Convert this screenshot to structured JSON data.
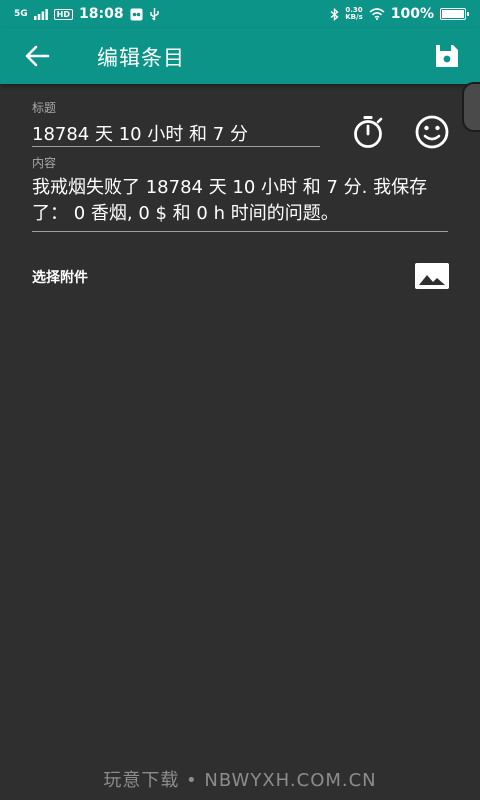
{
  "status_bar": {
    "signal": "5G",
    "hd_badge": "HD",
    "time": "18:08",
    "speed_value": "0.30",
    "speed_unit": "KB/s",
    "battery_text": "100%",
    "battery_level": 1.0
  },
  "app_bar": {
    "title": "编辑条目"
  },
  "form": {
    "title_label": "标题",
    "title_value": "18784 天 10 小时 和 7 分",
    "content_label": "内容",
    "content_value": "我戒烟失败了 18784 天 10 小时 和 7 分. 我保存了： 0 香烟, 0 $ 和 0 h 时间的问题。",
    "attachment_label": "选择附件"
  },
  "watermark": "玩意下载 • NBWYXH.COM.CN",
  "icons": {
    "back": "arrow-left-icon",
    "save": "save-icon",
    "timer": "stopwatch-icon",
    "emoji": "smiley-icon",
    "image": "image-icon"
  },
  "colors": {
    "primary": "#0d9488",
    "background": "#2f2f2f",
    "text": "#ffffff",
    "hint": "#a9a9a9"
  }
}
